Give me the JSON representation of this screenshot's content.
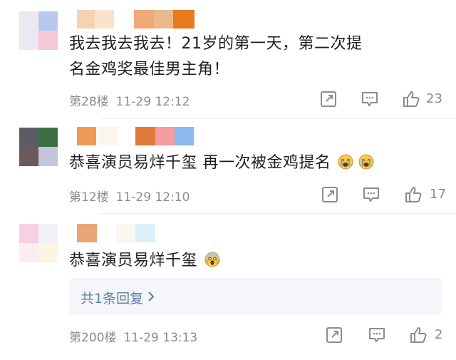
{
  "comments": [
    {
      "text": "我去我去我去！21岁的第一天，第二次提名金鸡奖最佳男主角！",
      "floor": "第28楼",
      "time": "11-29 12:12",
      "likes": "23",
      "avatar_colors": [
        "#ece8f1",
        "#b9c9ee",
        "#ece8f1",
        "#f4c9d6"
      ],
      "name_colors": [
        "#f6d3b0",
        "#f9e4cb",
        "#f0a877",
        "#e9b98a",
        "#e77a1e"
      ]
    },
    {
      "text": "恭喜演员易烊千玺 再一次被金鸡提名",
      "emojis": [
        "crying-emoji",
        "crying-emoji"
      ],
      "floor": "第12楼",
      "time": "11-29 12:10",
      "likes": "17",
      "avatar_colors": [
        "#5c5c66",
        "#3d6f45",
        "#6a5a5a",
        "#c5c5d9"
      ],
      "name_colors": [
        "#ef9a52",
        "#fbf5ec",
        "#e07a3a",
        "#f59c9c",
        "#8cb9ee"
      ]
    },
    {
      "text": "恭喜演员易烊千玺",
      "emojis": [
        "scream-emoji"
      ],
      "floor": "第200楼",
      "time": "11-29 13:13",
      "likes": "2",
      "reply_label": "共1条回复",
      "avatar_colors": [
        "#f9cfe4",
        "#f1f0f4",
        "#fbeef0",
        "#fcf5e4"
      ],
      "name_colors": [
        "#eaa577",
        "#fbf7f0",
        "#dbf1f9"
      ]
    }
  ],
  "icons": {
    "share": "share-icon",
    "comment": "comment-icon",
    "like": "like-icon",
    "chevron": "chevron-right-icon"
  }
}
